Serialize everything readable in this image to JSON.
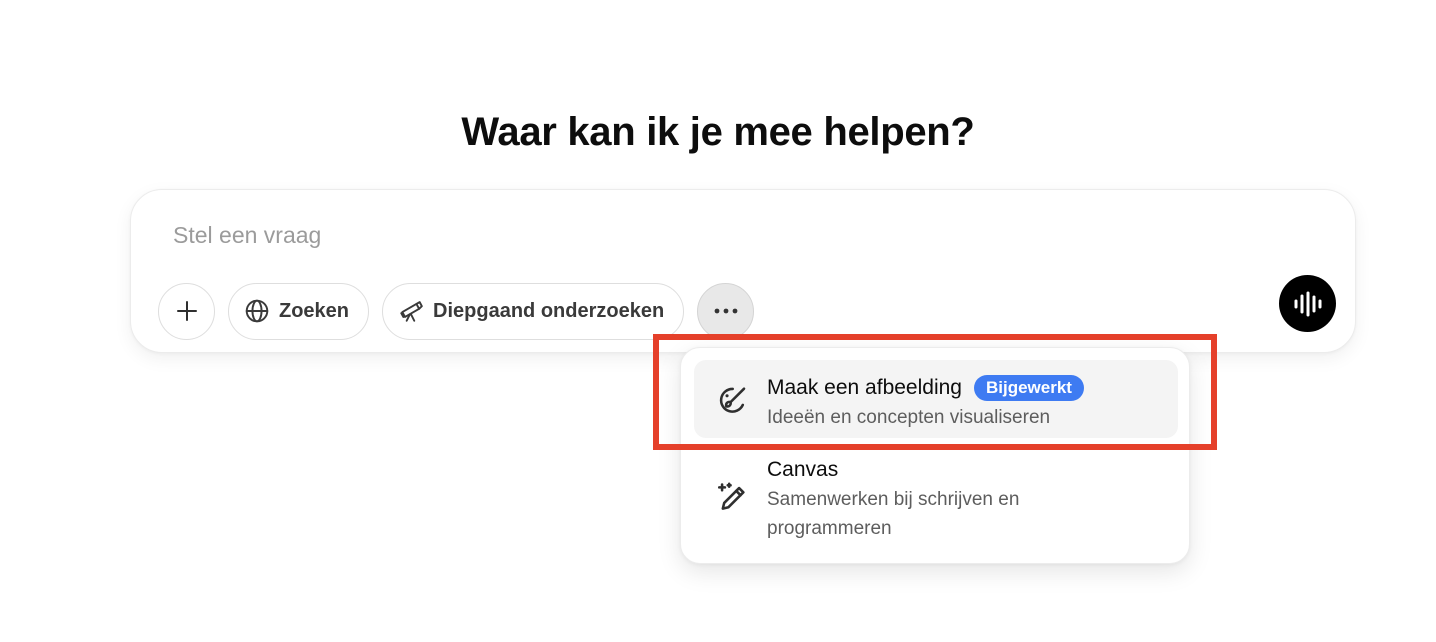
{
  "heading": "Waar kan ik je mee helpen?",
  "composer": {
    "placeholder": "Stel een vraag",
    "value": ""
  },
  "toolbar": {
    "add_icon": "plus-icon",
    "search": {
      "icon": "globe-icon",
      "label": "Zoeken"
    },
    "deep_research": {
      "icon": "telescope-icon",
      "label": "Diepgaand onderzoeken"
    },
    "more_icon": "ellipsis-icon",
    "voice_icon": "voice-waveform-icon"
  },
  "menu": {
    "items": [
      {
        "icon": "image-paint-icon",
        "title": "Maak een afbeelding",
        "badge": "Bijgewerkt",
        "description": "Ideeën en concepten visualiseren"
      },
      {
        "icon": "canvas-pen-icon",
        "title": "Canvas",
        "description_line1": "Samenwerken bij schrijven en",
        "description_line2": "programmeren"
      }
    ]
  },
  "colors": {
    "badge": "#3e7bf2",
    "highlight": "#e5402a",
    "voice_button": "#000000"
  }
}
